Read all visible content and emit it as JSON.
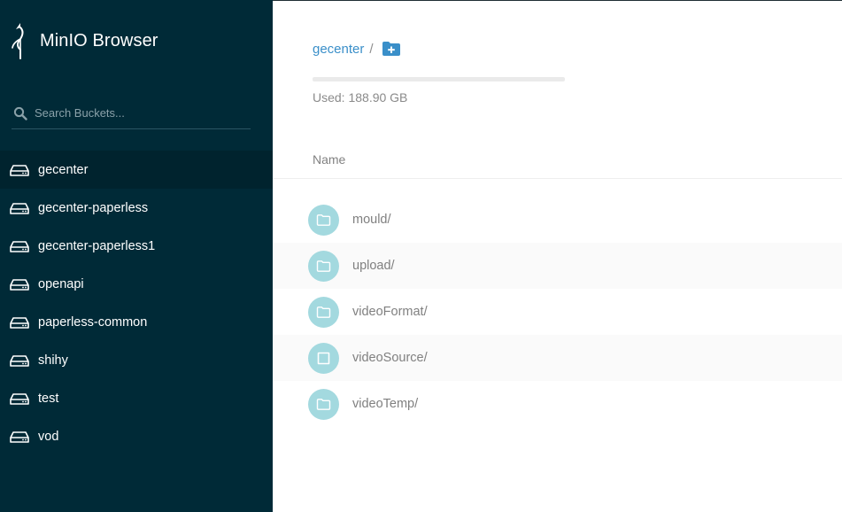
{
  "sidebar": {
    "brand_title": "MinIO Browser",
    "search_placeholder": "Search Buckets...",
    "buckets": [
      {
        "label": "gecenter",
        "active": true
      },
      {
        "label": "gecenter-paperless",
        "active": false
      },
      {
        "label": "gecenter-paperless1",
        "active": false
      },
      {
        "label": "openapi",
        "active": false
      },
      {
        "label": "paperless-common",
        "active": false
      },
      {
        "label": "shihy",
        "active": false
      },
      {
        "label": "test",
        "active": false
      },
      {
        "label": "vod",
        "active": false
      }
    ]
  },
  "main": {
    "breadcrumb": {
      "bucket": "gecenter",
      "separator": "/"
    },
    "usage": {
      "label": "Used: 188.90 GB"
    },
    "column_header": "Name",
    "items": [
      {
        "name": "mould/",
        "icon": "folder-icon"
      },
      {
        "name": "upload/",
        "icon": "folder-icon"
      },
      {
        "name": "videoFormat/",
        "icon": "folder-icon"
      },
      {
        "name": "videoSource/",
        "icon": "select-checkbox-icon"
      },
      {
        "name": "videoTemp/",
        "icon": "folder-icon"
      }
    ]
  },
  "colors": {
    "sidebar_bg": "#002a37",
    "sidebar_active": "#00232e",
    "link": "#3a8fc9",
    "folder_badge": "#a3d9df"
  }
}
